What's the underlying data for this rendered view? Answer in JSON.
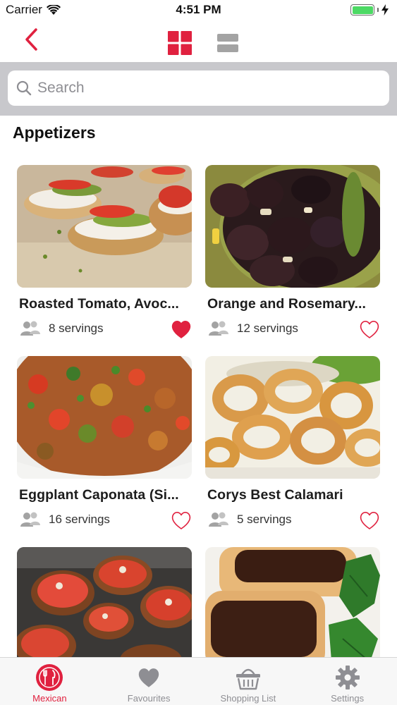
{
  "status_bar": {
    "carrier": "Carrier",
    "time": "4:51 PM"
  },
  "search": {
    "placeholder": "Search"
  },
  "section": {
    "title": "Appetizers"
  },
  "colors": {
    "accent": "#e0213f",
    "inactive": "#8e8e93"
  },
  "recipes": [
    {
      "title": "Roasted Tomato, Avoc...",
      "servings": "8 servings",
      "favourite": true,
      "image": "bruschetta with tomato and avocado"
    },
    {
      "title": "Orange and Rosemary...",
      "servings": "12 servings",
      "favourite": false,
      "image": "black olives in green bowl"
    },
    {
      "title": "Eggplant Caponata (Si...",
      "servings": "16 servings",
      "favourite": false,
      "image": "eggplant caponata"
    },
    {
      "title": "Corys Best Calamari",
      "servings": "5 servings",
      "favourite": false,
      "image": "fried calamari rings"
    },
    {
      "title": "",
      "servings": "",
      "favourite": false,
      "image": "topped bruschetta"
    },
    {
      "title": "",
      "servings": "",
      "favourite": false,
      "image": "chocolate spread toast with mint"
    }
  ],
  "tabs": [
    {
      "label": "Mexican",
      "icon": "fork-knife-plate-icon",
      "active": true
    },
    {
      "label": "Favourites",
      "icon": "heart-icon",
      "active": false
    },
    {
      "label": "Shopping List",
      "icon": "basket-icon",
      "active": false
    },
    {
      "label": "Settings",
      "icon": "gear-icon",
      "active": false
    }
  ]
}
